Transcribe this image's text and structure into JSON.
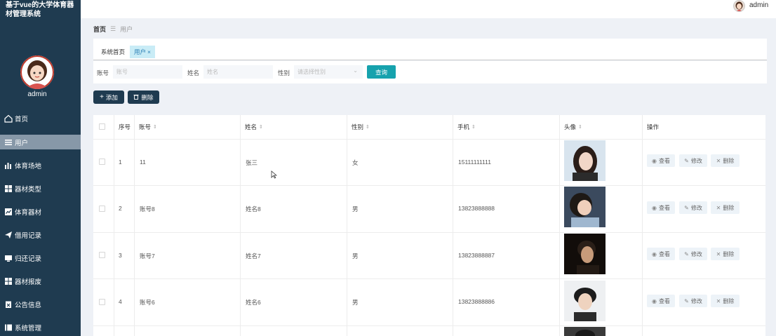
{
  "app": {
    "title": "基于vue的大学体育器材管理系统"
  },
  "sidebar": {
    "username": "admin",
    "items": [
      {
        "label": "首页",
        "icon": "home-icon"
      },
      {
        "label": "用户",
        "icon": "list-icon",
        "active": true
      },
      {
        "label": "体育场地",
        "icon": "bar-chart-icon"
      },
      {
        "label": "器材类型",
        "icon": "grid-icon"
      },
      {
        "label": "体育器材",
        "icon": "line-chart-icon"
      },
      {
        "label": "借用记录",
        "icon": "paper-plane-icon"
      },
      {
        "label": "归还记录",
        "icon": "monitor-icon"
      },
      {
        "label": "器材报废",
        "icon": "grid-icon"
      },
      {
        "label": "公告信息",
        "icon": "clipboard-icon"
      },
      {
        "label": "系统管理",
        "icon": "book-icon"
      }
    ]
  },
  "header": {
    "username": "admin"
  },
  "breadcrumb": {
    "home": "首页",
    "separator": "☰",
    "current": "用户"
  },
  "tabs": [
    {
      "label": "系统首页"
    },
    {
      "label": "用户",
      "close": "×",
      "active": true
    }
  ],
  "search": {
    "account_label": "账号",
    "account_placeholder": "账号",
    "name_label": "姓名",
    "name_placeholder": "姓名",
    "gender_label": "性别",
    "gender_placeholder": "请选择性别",
    "query_label": "查询"
  },
  "actions": {
    "add_label": "添加",
    "delete_label": "删除"
  },
  "table": {
    "headers": {
      "index": "序号",
      "account": "账号",
      "name": "姓名",
      "gender": "性别",
      "phone": "手机",
      "avatar": "头像",
      "ops": "操作"
    },
    "sort_icon": "⇕",
    "rows": [
      {
        "index": "1",
        "account": "11",
        "name": "张三",
        "gender": "女",
        "phone": "15111111111"
      },
      {
        "index": "2",
        "account": "账号8",
        "name": "姓名8",
        "gender": "男",
        "phone": "13823888888"
      },
      {
        "index": "3",
        "account": "账号7",
        "name": "姓名7",
        "gender": "男",
        "phone": "13823888887"
      },
      {
        "index": "4",
        "account": "账号6",
        "name": "姓名6",
        "gender": "男",
        "phone": "13823888886"
      }
    ],
    "row_actions": {
      "view": "查看",
      "edit": "修改",
      "delete": "删除"
    }
  },
  "colors": {
    "sidebar": "#1f3b50",
    "active_menu": "#8798a8",
    "accent": "#16a2ad",
    "tab_active": "#c9ecf6"
  }
}
